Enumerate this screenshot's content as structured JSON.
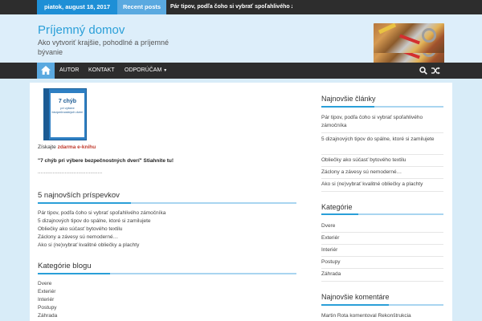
{
  "topbar": {
    "date": "piatok, august 18, 2017",
    "recent_label": "Recent posts",
    "ticker": "Pár tipov, podľa čoho si vybrať spoľahlivého zámo"
  },
  "header": {
    "site_title": "Príjemný domov",
    "site_desc": "Ako vytvoriť krajšie, pohodlné a príjemné bývanie"
  },
  "nav": {
    "items": [
      "AUTOR",
      "KONTAKT",
      "ODPORÚČAM"
    ]
  },
  "left": {
    "book": {
      "title": "7 chýb",
      "subtitle": "pri výbere bezpečnostných dverí"
    },
    "ebook_prefix": "Získajte ",
    "ebook_link": "zdarma e-knihu",
    "ebook_promo": "\"7 chýb pri výbere bezpečnostných dverí\" Stiahnite tu!",
    "dots": "...........................................",
    "recent_title": "5 najnovších príspevkov",
    "recent_posts": [
      "Pár tipov, podľa čoho si vybrať spoľahlivého zámočníka",
      "5 dizajnových tipov do spálne, ktoré si zamilujete",
      "Obliečky ako súčasť bytového textilu",
      "Záclony a závesy sú nemoderné…",
      "Ako si (ne)vybrať kvalitné obliečky a plachty"
    ],
    "cat_title": "Kategórie blogu",
    "categories": [
      "Dvere",
      "Exteriér",
      "Interiér",
      "Postupy",
      "Záhrada"
    ]
  },
  "right": {
    "new_title": "Najnovšie články",
    "new_articles": [
      "Pár tipov, podľa čoho si vybrať spoľahlivého zámočníka",
      "5 dizajnových tipov do spálne, ktoré si zamilujete",
      "Obliečky ako súčasť bytového textilu",
      "Záclony a závesy sú nemoderné…",
      "Ako si (ne)vybrať kvalitné obliečky a plachty"
    ],
    "cat_title": "Kategórie",
    "categories": [
      "Dvere",
      "Exteriér",
      "Interiér",
      "Postupy",
      "Záhrada"
    ],
    "comments_title": "Najnovšie komentáre",
    "comment": "Martin Rota komentoval Rekonštrukcia"
  },
  "colors": {
    "accent": "#2a9fd8",
    "topbar": "#2d2d2d",
    "date_bg": "#1e8fd6",
    "link_red": "#c0392b"
  }
}
